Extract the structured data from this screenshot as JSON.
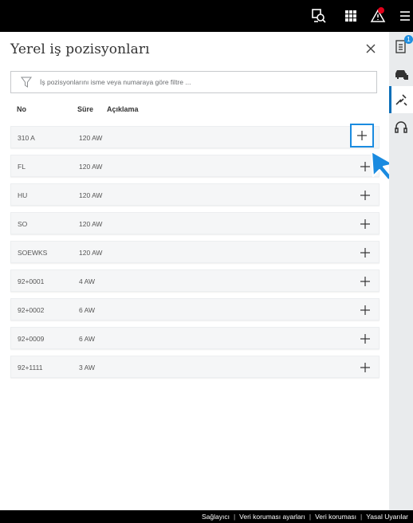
{
  "topbar": {
    "icons": [
      "diagnosis-search-icon",
      "grid-apps-icon",
      "warning-alert-icon",
      "hamburger-menu-icon"
    ]
  },
  "panel": {
    "title": "Yerel iş pozisyonları",
    "filter_placeholder": "İş pozisyonlarını isme veya numaraya göre filtre ..."
  },
  "columns": {
    "no": "No",
    "duration": "Süre",
    "description": "Açıklama"
  },
  "rows": [
    {
      "no": "310 A",
      "duration": "120 AW",
      "description": ""
    },
    {
      "no": "FL",
      "duration": "120 AW",
      "description": ""
    },
    {
      "no": "HU",
      "duration": "120 AW",
      "description": ""
    },
    {
      "no": "SO",
      "duration": "120 AW",
      "description": ""
    },
    {
      "no": "SOEWKS",
      "duration": "120 AW",
      "description": ""
    },
    {
      "no": "92+0001",
      "duration": "4 AW",
      "description": ""
    },
    {
      "no": "92+0002",
      "duration": "6 AW",
      "description": ""
    },
    {
      "no": "92+0009",
      "duration": "6 AW",
      "description": ""
    },
    {
      "no": "92+1111",
      "duration": "3 AW",
      "description": ""
    }
  ],
  "rail": {
    "icons": [
      "checklist-icon",
      "car-icon",
      "tools-icon",
      "headset-icon"
    ],
    "checklist_badge": "1"
  },
  "footer": {
    "links": [
      "Sağlayıcı",
      "Veri koruması ayarları",
      "Veri koruması",
      "Yasal Uyarılar"
    ]
  },
  "colors": {
    "accent": "#1a8be0",
    "topbar_bg": "#000000",
    "alert": "#e1001a",
    "row_bg": "#f5f6f7"
  }
}
